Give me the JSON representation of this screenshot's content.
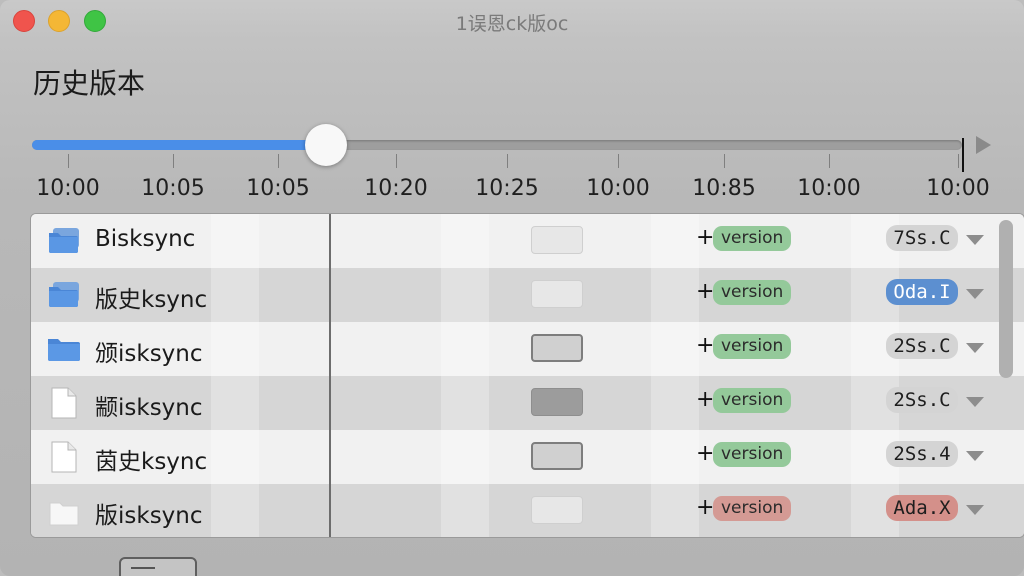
{
  "window": {
    "title": "1误恩ck版oc"
  },
  "page": {
    "title": "历史版本"
  },
  "timeline": {
    "position": 0.31,
    "ticks": [
      "10:00",
      "10:05",
      "10:05",
      "10:20",
      "10:25",
      "10:00",
      "10:85",
      "10:00",
      "10:00"
    ]
  },
  "rows": [
    {
      "name": "Bisksync",
      "icon": "folder-stack-icon",
      "preview": "faint",
      "plus": "+",
      "version": "version",
      "version_style": "green",
      "badge": "7Ss.C",
      "badge_style": "gray"
    },
    {
      "name": "版史ksync",
      "icon": "folder-stack-icon",
      "preview": "faint",
      "plus": "+",
      "version": "version",
      "version_style": "green",
      "badge": "Oda.I",
      "badge_style": "blue"
    },
    {
      "name": "颁isksync",
      "icon": "folder-icon",
      "preview": "outline",
      "plus": "+",
      "version": "version",
      "version_style": "green",
      "badge": "2Ss.C",
      "badge_style": "gray"
    },
    {
      "name": "颛isksync",
      "icon": "document-icon",
      "preview": "solid",
      "plus": "+",
      "version": "version",
      "version_style": "green",
      "badge": "2Ss.C",
      "badge_style": "gray"
    },
    {
      "name": "茵史ksync",
      "icon": "document-icon",
      "preview": "outline",
      "plus": "+",
      "version": "version",
      "version_style": "green",
      "badge": "2Ss.4",
      "badge_style": "gray"
    },
    {
      "name": "版isksync",
      "icon": "document-faint-icon",
      "preview": "faint",
      "plus": "+",
      "version": "version",
      "version_style": "red",
      "badge": "Ada.X",
      "badge_style": "red"
    }
  ],
  "colors": {
    "accent": "#4a8ee8",
    "version_green": "#94c99a",
    "version_red": "#d49a94",
    "badge_blue": "#5c8fd0"
  }
}
